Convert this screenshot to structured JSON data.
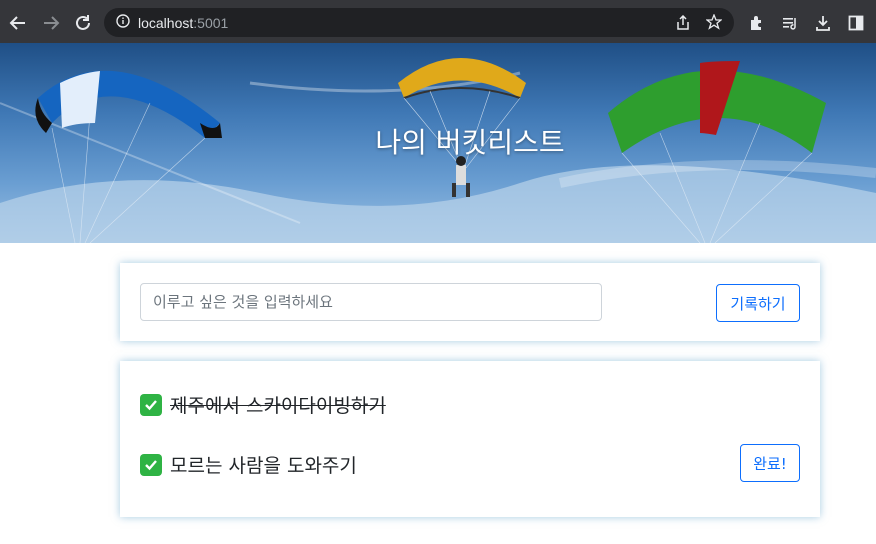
{
  "browser": {
    "url_host": "localhost",
    "url_port": ":5001"
  },
  "hero": {
    "title": "나의 버킷리스트"
  },
  "form": {
    "placeholder": "이루고 싶은 것을 입력하세요",
    "save_label": "기록하기"
  },
  "buckets": [
    {
      "text": "제주에서 스카이다이빙하기",
      "done": true
    },
    {
      "text": "모르는 사람을 도와주기",
      "done": false,
      "button": "완료!"
    }
  ],
  "colors": {
    "accent": "#0d6efd",
    "check": "#2fb344"
  }
}
